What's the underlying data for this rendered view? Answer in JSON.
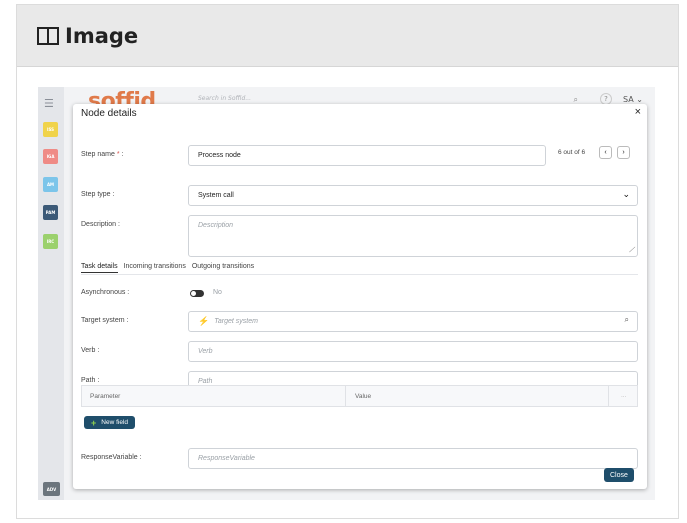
{
  "frame": {
    "title": "Image"
  },
  "app": {
    "logo": "soffid",
    "search_placeholder": "Search in Soffid...",
    "help": "?",
    "user": "SA ⌄",
    "modules": [
      {
        "label": "ISS",
        "color": "#f0d34a"
      },
      {
        "label": "IGA",
        "color": "#ef8b86"
      },
      {
        "label": "AM",
        "color": "#7cc5ea"
      },
      {
        "label": "PAM",
        "color": "#3c5a78"
      },
      {
        "label": "IRC",
        "color": "#9bd16d"
      }
    ],
    "adv": "ADV"
  },
  "modal": {
    "title": "Node details",
    "close_x": "×",
    "step_name": {
      "label": "Step name",
      "required": "*",
      "suffix": " :",
      "value": "Process node"
    },
    "counter": "6 out of 6",
    "prev": "‹",
    "next": "›",
    "step_type": {
      "label": "Step type :",
      "value": "System call"
    },
    "description": {
      "label": "Description :",
      "placeholder": "Description"
    },
    "tabs": [
      "Task details",
      "Incoming transitions",
      "Outgoing transitions"
    ],
    "asynchronous": {
      "label": "Asynchronous :",
      "value": "No"
    },
    "target_system": {
      "label": "Target system :",
      "placeholder": "Target system"
    },
    "verb": {
      "label": "Verb :",
      "placeholder": "Verb"
    },
    "path": {
      "label": "Path :",
      "placeholder": "Path"
    },
    "table": {
      "col1": "Parameter",
      "col2": "Value",
      "col3": "..."
    },
    "new_field": "New field",
    "response_variable": {
      "label": "ResponseVariable :",
      "placeholder": "ResponseVariable"
    },
    "close_button": "Close"
  }
}
